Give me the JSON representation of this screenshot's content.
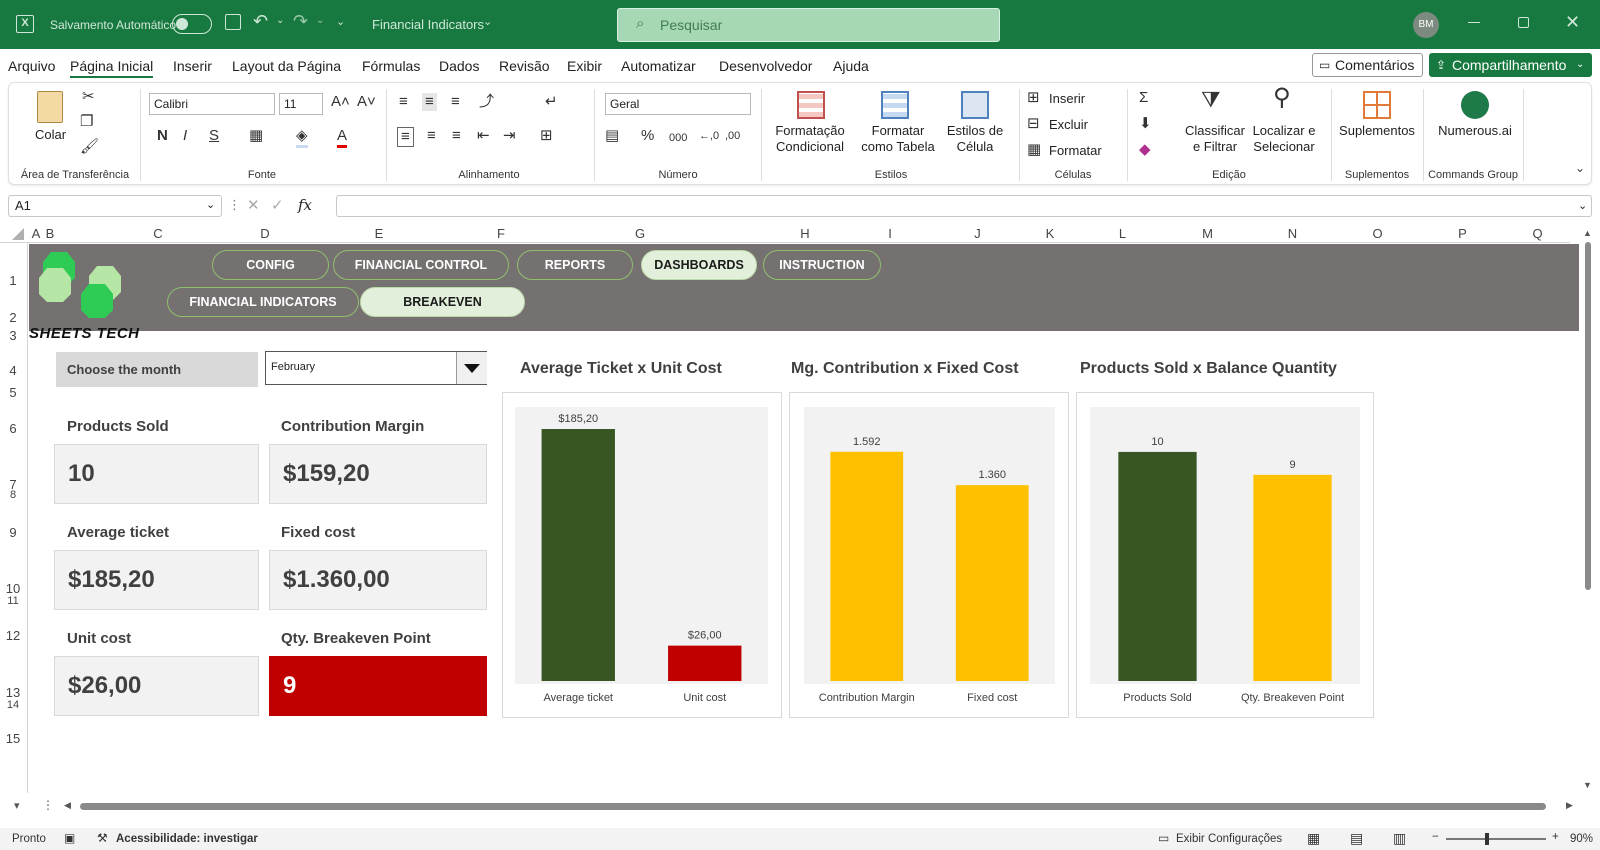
{
  "titlebar": {
    "autosave_label": "Salvamento Automático",
    "doc_title": "Financial Indicators",
    "search_placeholder": "Pesquisar",
    "avatar_initials": "BM"
  },
  "menu": {
    "items": [
      "Arquivo",
      "Página Inicial",
      "Inserir",
      "Layout da Página",
      "Fórmulas",
      "Dados",
      "Revisão",
      "Exibir",
      "Automatizar",
      "Desenvolvedor",
      "Ajuda"
    ],
    "comments": "Comentários",
    "share": "Compartilhamento"
  },
  "ribbon": {
    "paste": "Colar",
    "clipboard_group": "Área de Transferência",
    "font_name": "Calibri",
    "font_size": "11",
    "font_group": "Fonte",
    "alignment_group": "Alinhamento",
    "number_format": "Geral",
    "number_group": "Número",
    "cond_format": "Formatação Condicional",
    "format_table": "Formatar como Tabela",
    "cell_styles": "Estilos de Célula",
    "styles_group": "Estilos",
    "insert": "Inserir",
    "delete": "Excluir",
    "format": "Formatar",
    "cells_group": "Células",
    "sort_filter": "Classificar e Filtrar",
    "find_select": "Localizar e Selecionar",
    "editing_group": "Edição",
    "addins": "Suplementos",
    "addins_group": "Suplementos",
    "numerous": "Numerous.ai",
    "commands_group": "Commands Group"
  },
  "formula_bar": {
    "name_box": "A1",
    "fx": "fx"
  },
  "columns": [
    "A",
    "B",
    "C",
    "D",
    "E",
    "F",
    "G",
    "H",
    "I",
    "J",
    "K",
    "L",
    "M",
    "N",
    "O",
    "P",
    "Q"
  ],
  "rows": [
    "1",
    "2",
    "3",
    "4",
    "5",
    "6",
    "7",
    "8",
    "9",
    "10",
    "11",
    "12",
    "13",
    "14",
    "15"
  ],
  "dashboard": {
    "brand": "SHEETS TECH",
    "nav_row1": [
      "CONFIG",
      "FINANCIAL CONTROL",
      "REPORTS",
      "DASHBOARDS",
      "INSTRUCTION"
    ],
    "nav_row2": [
      "FINANCIAL INDICATORS",
      "BREAKEVEN"
    ],
    "month_label": "Choose the month",
    "month_value": "February",
    "kpis": [
      {
        "label": "Products Sold",
        "value": "10"
      },
      {
        "label": "Contribution Margin",
        "value": "$159,20"
      },
      {
        "label": "Average ticket",
        "value": "$185,20"
      },
      {
        "label": "Fixed cost",
        "value": "$1.360,00"
      },
      {
        "label": "Unit cost",
        "value": "$26,00"
      },
      {
        "label": "Qty. Breakeven Point",
        "value": "9"
      }
    ],
    "colors": {
      "dark_green": "#375623",
      "red": "#c00000",
      "yellow": "#ffc000",
      "band": "#767171"
    }
  },
  "chart_data": [
    {
      "type": "bar",
      "title": "Average Ticket x Unit Cost",
      "categories": [
        "Average ticket",
        "Unit cost"
      ],
      "values": [
        185.2,
        26
      ],
      "data_labels": [
        "$185,20",
        "$26,00"
      ],
      "colors": [
        "#375623",
        "#c00000"
      ],
      "ylim": [
        0,
        185.2
      ],
      "grid": false
    },
    {
      "type": "bar",
      "title": "Mg. Contribution x Fixed Cost",
      "categories": [
        "Contribution Margin",
        "Fixed cost"
      ],
      "values": [
        1592,
        1360
      ],
      "data_labels": [
        "1.592",
        "1.360"
      ],
      "colors": [
        "#ffc000",
        "#ffc000"
      ],
      "ylim": [
        0,
        1750
      ],
      "grid": false
    },
    {
      "type": "bar",
      "title": "Products Sold x Balance Quantity",
      "categories": [
        "Products Sold",
        "Qty. Breakeven Point"
      ],
      "values": [
        10,
        9
      ],
      "data_labels": [
        "10",
        "9"
      ],
      "colors": [
        "#375623",
        "#ffc000"
      ],
      "ylim": [
        0,
        11
      ],
      "grid": false
    }
  ],
  "status": {
    "ready": "Pronto",
    "accessibility": "Acessibilidade: investigar",
    "display_settings": "Exibir Configurações",
    "zoom": "90%"
  }
}
